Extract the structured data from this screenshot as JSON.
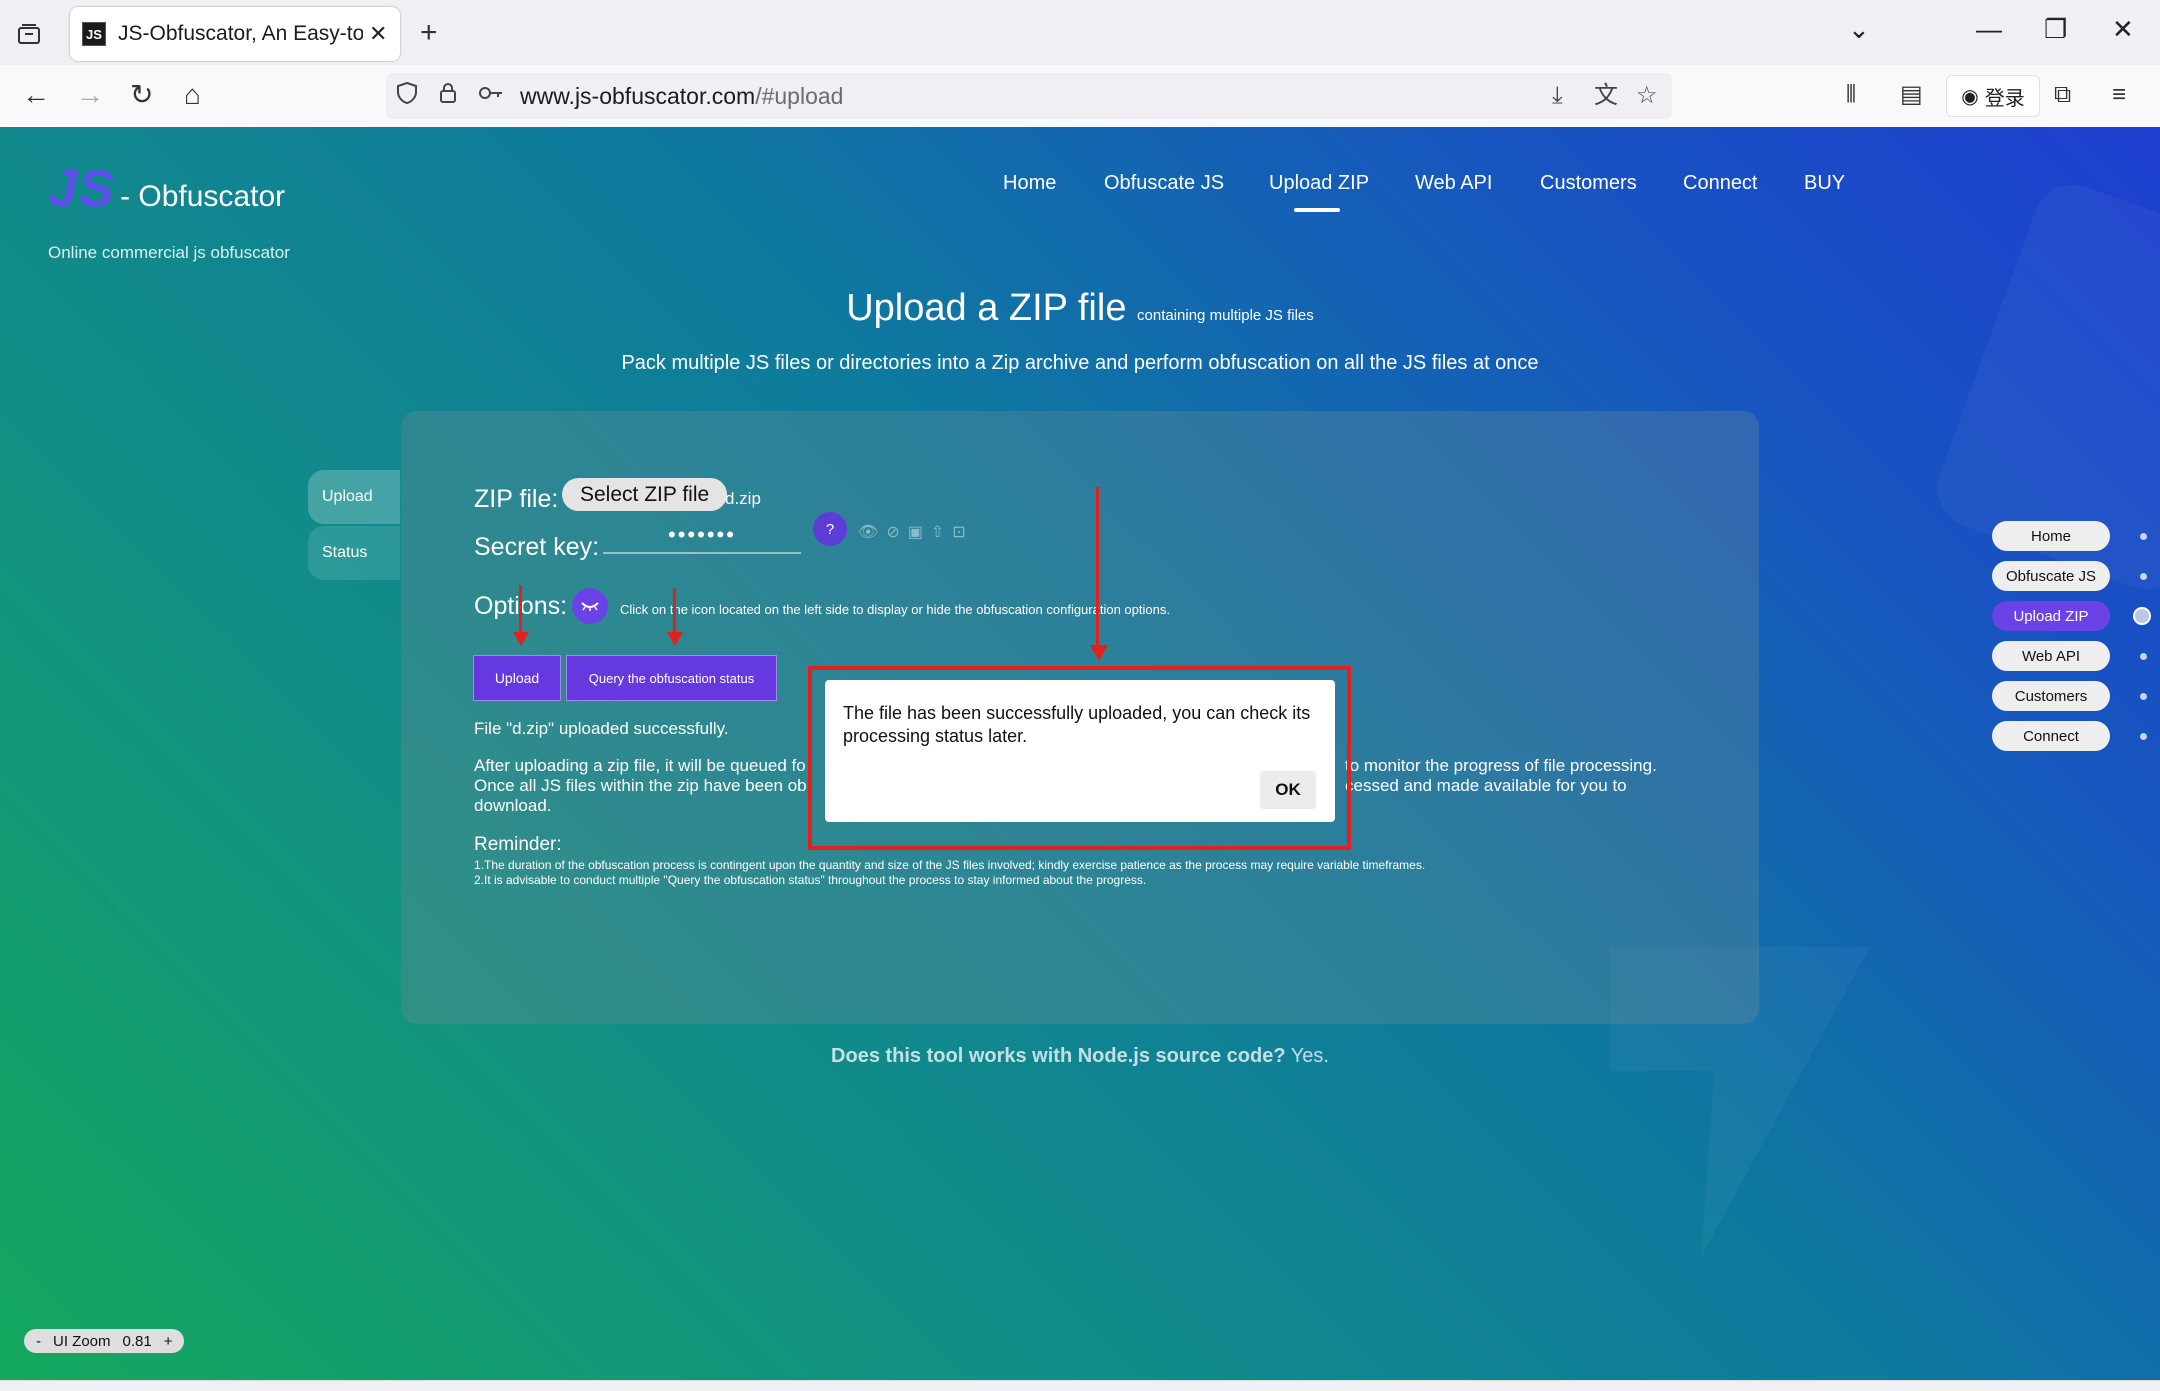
{
  "browser": {
    "tab_title": "JS-Obfuscator, An Easy-to-use",
    "favicon_text": "JS",
    "url_host": "www.js-obfuscator.com",
    "url_path": "/#upload",
    "login_label": "登录"
  },
  "site": {
    "logo_js": "JS",
    "logo_name": "- Obfuscator",
    "tagline": "Online commercial js obfuscator",
    "nav": [
      "Home",
      "Obfuscate JS",
      "Upload ZIP",
      "Web API",
      "Customers",
      "Connect",
      "BUY"
    ],
    "active_nav": "Upload ZIP"
  },
  "main": {
    "title": "Upload a ZIP file",
    "title_small": "containing multiple JS files",
    "subtitle": "Pack multiple JS files or directories into a Zip archive and perform obfuscation on all the JS files at once",
    "side_tabs": [
      "Upload",
      "Status"
    ],
    "zip_label": "ZIP file:",
    "select_button": "Select ZIP file",
    "file_name": "d.zip",
    "secret_label": "Secret key:",
    "secret_value": "•••••••",
    "help_label": "?",
    "options_label": "Options:",
    "options_hint": "Click on the icon located on the left side to display or hide the obfuscation configuration options.",
    "upload_button": "Upload",
    "query_button": "Query the obfuscation status",
    "upload_result": "File \"d.zip\" uploaded successfully.",
    "info_line1_left": "After uploading a zip file, it will be queued fo",
    "info_line1_right": "to monitor the progress of file processing.",
    "info_line2_left": "Once all JS files within the zip have been ob",
    "info_line2_right": "cessed and made available for you to",
    "info_line3": "download.",
    "reminder_title": "Reminder:",
    "reminder_1": "1.The duration of the obfuscation process is contingent upon the quantity and size of the JS files involved; kindly exercise patience as the process may require variable timeframes.",
    "reminder_2": "2.It is advisable to conduct multiple \"Query the obfuscation status\" throughout the process to stay informed about the progress.",
    "faq_question": "Does this tool works with Node.js source code?",
    "faq_answer": "Yes."
  },
  "right_nav": [
    "Home",
    "Obfuscate JS",
    "Upload ZIP",
    "Web API",
    "Customers",
    "Connect"
  ],
  "zoom": {
    "minus": "-",
    "label": "UI Zoom",
    "value": "0.81",
    "plus": "+"
  },
  "dialog": {
    "message": "The file has been successfully uploaded, you can check its processing status later.",
    "ok": "OK"
  },
  "colors": {
    "accent": "#6538e0",
    "highlight": "#e3201b"
  }
}
